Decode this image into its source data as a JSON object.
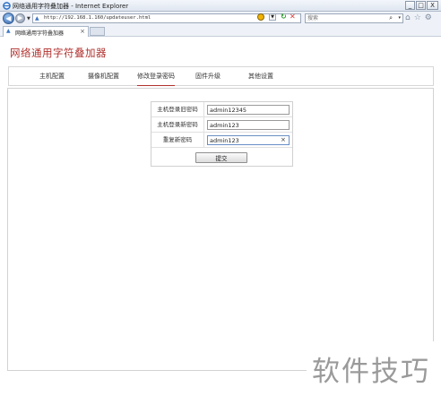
{
  "window": {
    "title": "网络通用字符叠加器 - Internet Explorer",
    "buttons": {
      "minimize": "_",
      "maximize": "□",
      "close": "X"
    }
  },
  "address_bar": {
    "url": "http://192.168.1.160/updateuser.html",
    "back_glyph": "◀",
    "forward_glyph": "▶",
    "refresh_glyph": "↻",
    "stop_glyph": "✕",
    "dropdown_glyph": "▼"
  },
  "search": {
    "placeholder": "搜索",
    "glass_glyph": "⌕",
    "dropdown_glyph": "▾"
  },
  "toolbar_icons": {
    "home": "⌂",
    "favorites": "☆",
    "tools": "⚙"
  },
  "tab": {
    "title": "网络通用字符叠加器",
    "close": "×"
  },
  "page": {
    "app_title": "网络通用字符叠加器",
    "nav": [
      {
        "label": "主机配置"
      },
      {
        "label": "摄像机配置"
      },
      {
        "label": "修改登录密码"
      },
      {
        "label": "固件升级"
      },
      {
        "label": "其他设置"
      }
    ],
    "active_nav": "修改登录密码",
    "form": {
      "old_password": {
        "label": "主机登录旧密码",
        "value": "admin12345"
      },
      "new_password": {
        "label": "主机登录新密码",
        "value": "admin123"
      },
      "repeat_password": {
        "label": "重复新密码",
        "value": "admin123",
        "clear": "×"
      },
      "submit_label": "提交"
    }
  },
  "watermark": {
    "text": "软件技巧"
  },
  "colors": {
    "accent": "#b0322f",
    "border": "#d2d2d2",
    "chrome": "#eef2f8"
  }
}
